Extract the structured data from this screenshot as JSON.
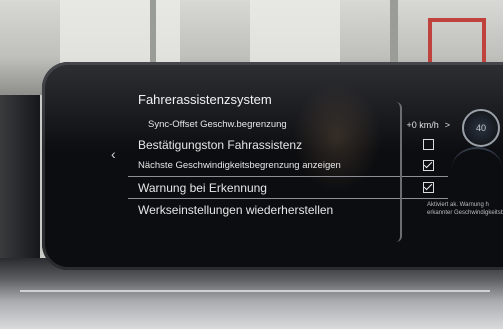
{
  "screen": {
    "title": "Fahrerassistenzsystem",
    "items": [
      {
        "label": "Sync-Offset Geschw.begrenzung",
        "value": "+0 km/h",
        "chevron": ">"
      },
      {
        "label": "Bestätigungston Fahrassistenz",
        "checked": false
      },
      {
        "label": "Nächste Geschwindigkeitsbegrenzung anzeigen",
        "checked": true
      },
      {
        "label": "Warnung bei Erkennung",
        "checked": true
      },
      {
        "label": "Werkseinstellungen wiederherstellen"
      }
    ],
    "back_icon": "chevron-left-icon"
  },
  "right_panel": {
    "sign_value": "40",
    "description": "Aktiviert ak. Warnung h erkannter Geschwindigkeitsb"
  }
}
